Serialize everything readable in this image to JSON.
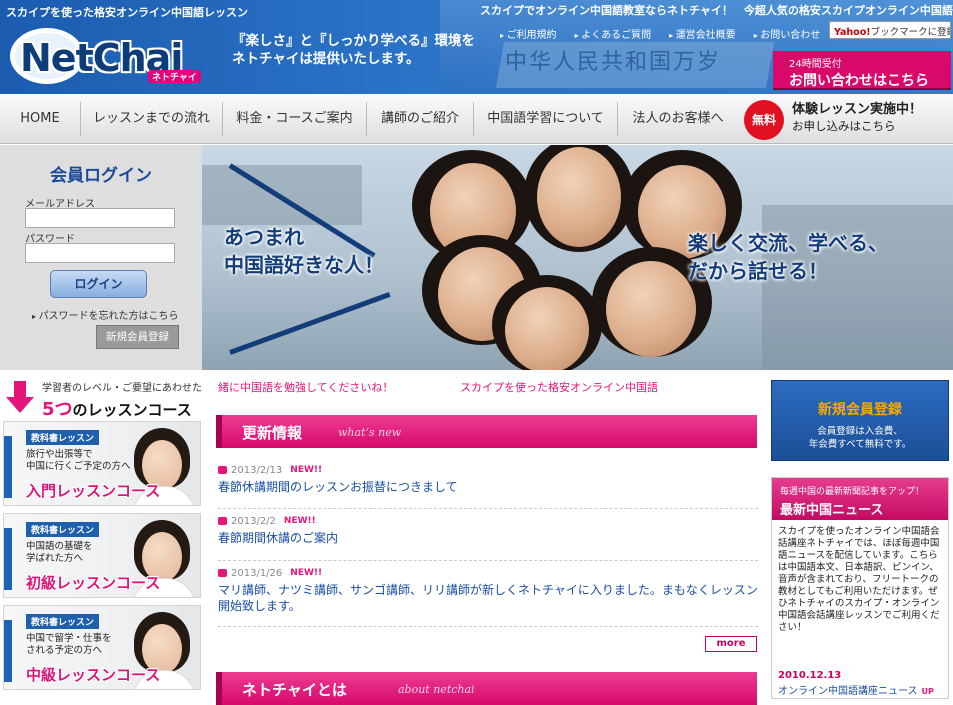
{
  "header": {
    "tagline": "スカイプを使った格安オンライン中国語レッスン",
    "logo_text": "NetChai",
    "logo_kana": "ネトチャイ",
    "slogan_line1": "『楽しさ』と『しっかり学べる』環境を",
    "slogan_line2": "ネトチャイは提供いたします。",
    "top_title": "スカイプでオンライン中国語教室ならネトチャイ！　今超人気の格安スカイプオンライン中国語教室",
    "sign_text": "中华人民共和国万岁",
    "links": [
      "ご利用規約",
      "よくあるご質問",
      "運営会社概要",
      "お問い合わせ"
    ],
    "yahoo_y": "Yahoo!",
    "yahoo_label": "ブックマークに登録",
    "contact_small": "24時間受付",
    "contact_big": "お問い合わせはこちら"
  },
  "nav": {
    "items": [
      "HOME",
      "レッスンまでの流れ",
      "料金・コースご案内",
      "講師のご紹介",
      "中国語学習について",
      "法人のお客様へ"
    ],
    "free_badge": "無料",
    "trial_line1": "体験レッスン実施中！",
    "trial_line2": "お申し込みはこちら"
  },
  "login": {
    "title": "会員ログイン",
    "email_label": "メールアドレス",
    "password_label": "パスワード",
    "login_button": "ログイン",
    "forgot_link": "パスワードを忘れた方はこちら",
    "register_button": "新規会員登録"
  },
  "hero": {
    "left_line1": "あつまれ",
    "left_line2": "中国語好きな人！",
    "right_line1": "楽しく交流、学べる、",
    "right_line2": "だから話せる！"
  },
  "courses": {
    "head_small": "学習者のレベル・ご要望にあわせた",
    "head_num": "5つ",
    "head_rest": "のレッスンコース",
    "items": [
      {
        "badge": "教科書レッスン",
        "desc1": "旅行や出張等で",
        "desc2": "中国に行くご予定の方へ",
        "name": "入門レッスンコース"
      },
      {
        "badge": "教科書レッスン",
        "desc1": "中国語の基礎を",
        "desc2": "学ばれた方へ",
        "name": "初級レッスンコース"
      },
      {
        "badge": "教科書レッスン",
        "desc1": "中国で留学・仕事を",
        "desc2": "される予定の方へ",
        "name": "中級レッスンコース"
      }
    ]
  },
  "ticker": {
    "text1": "緒に中国語を勉強してくださいね！",
    "text2": "スカイプを使った格安オンライン中国語"
  },
  "updates": {
    "title": "更新情報",
    "en": "what’s new",
    "new_label": "NEW!!",
    "items": [
      {
        "date": "2013/2/13",
        "text": "春節休講期間のレッスンお振替につきまして"
      },
      {
        "date": "2013/2/2",
        "text": "春節期間休講のご案内"
      },
      {
        "date": "2013/1/26",
        "text": "マリ講師、ナツミ講師、サンゴ講師、リリ講師が新しくネトチャイに入りました。まもなくレッスン開始致します。"
      }
    ],
    "more": "more"
  },
  "about": {
    "title": "ネトチャイとは",
    "en": "about netchai"
  },
  "sidebar": {
    "register_title": "新規会員登録",
    "register_sub1": "会員登録は入会費、",
    "register_sub2": "年会費すべて無料です。",
    "news_small": "毎週中国の最新新聞記事をアップ！",
    "news_title": "最新中国ニュース",
    "news_body": "スカイプを使ったオンライン中国語会話講座ネトチャイでは、ほぼ毎週中国語ニュースを配信しています。こちらは中国語本文、日本語訳、ピンイン、音声が含まれており、フリートークの教材としてもご利用いただけます。ぜひネトチャイのスカイプ・オンライン中国語会話講座レッスンでご利用ください！",
    "news_date": "2010.12.13",
    "news_item": "オンライン中国語講座ニュース",
    "news_up": "UP"
  }
}
